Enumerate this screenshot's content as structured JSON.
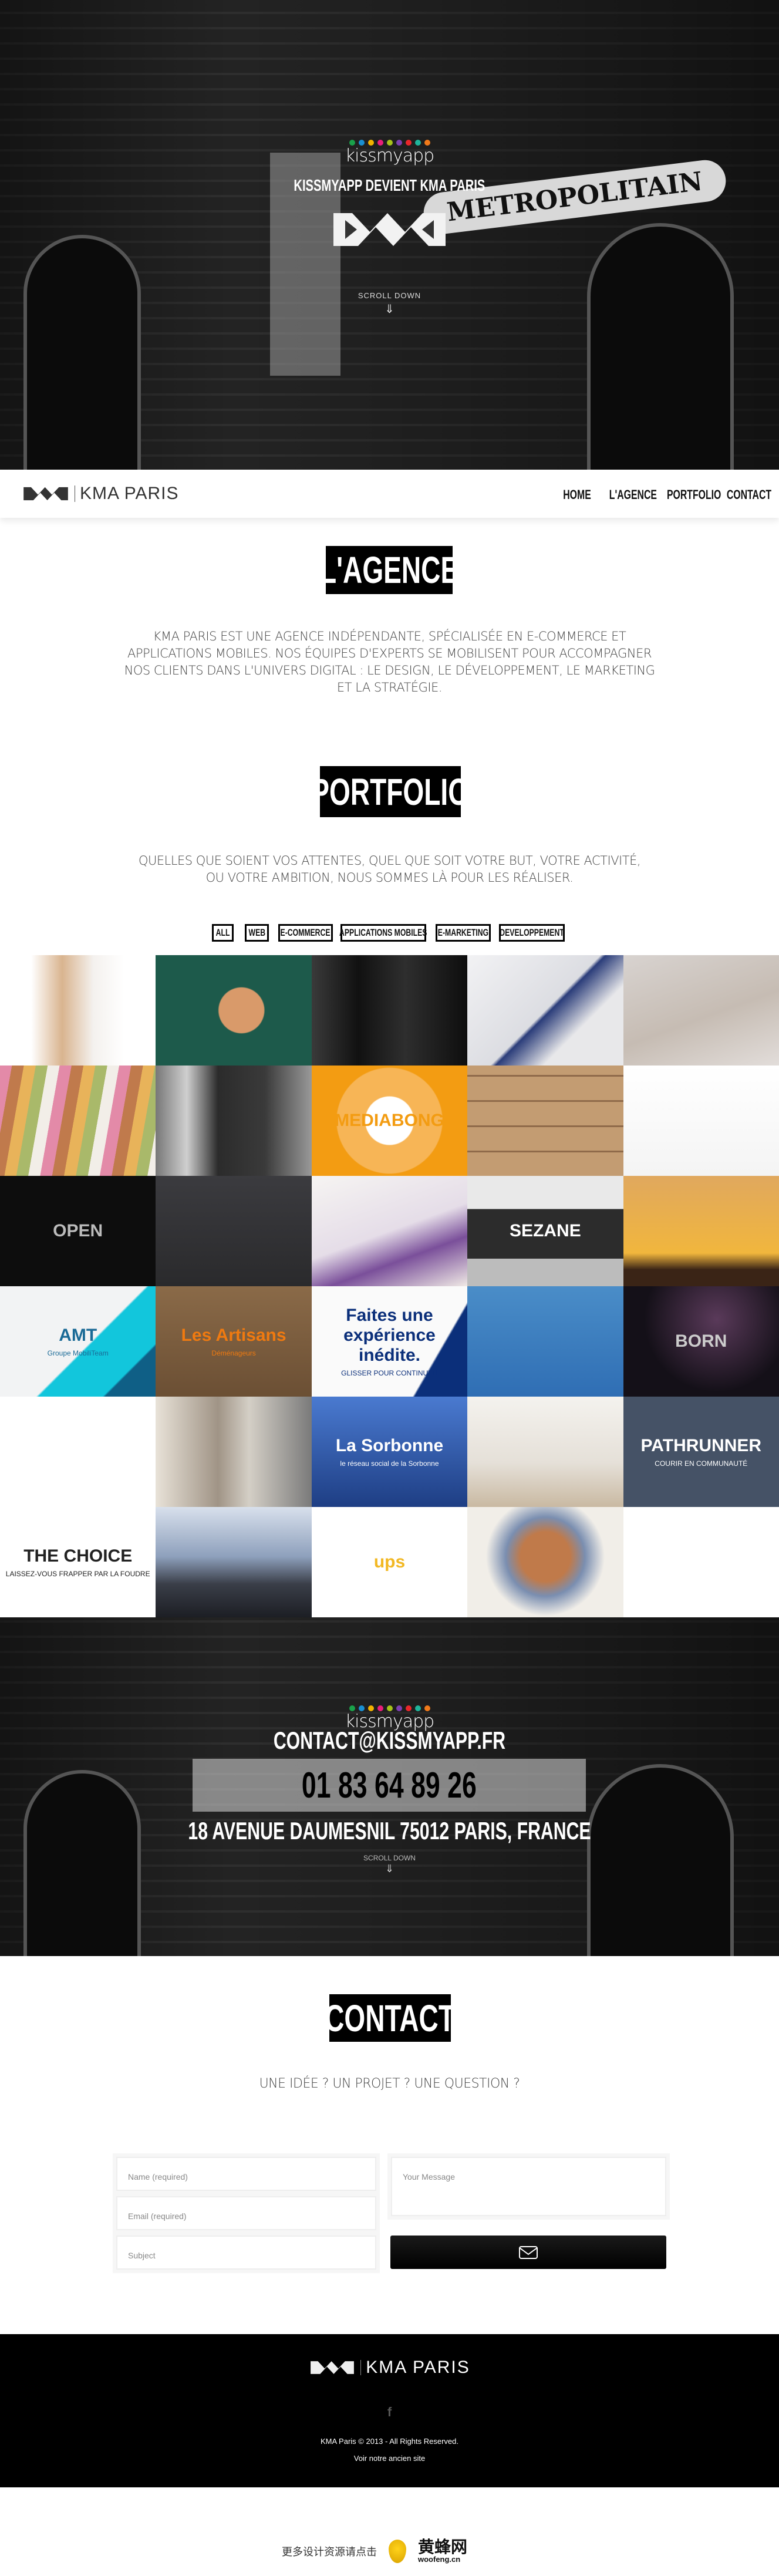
{
  "hero": {
    "brand_dots": [
      "#1aa14a",
      "#1a8fd1",
      "#f2b200",
      "#e91e7a",
      "#a6c21a",
      "#7b3fb0",
      "#e8262a",
      "#1fb39a",
      "#f07a1a"
    ],
    "brand_name": "kissmyapp",
    "title": "KISSMYAPP DEVIENT KMA PARIS",
    "sign_text": "METROPOLITAIN",
    "scroll_label": "SCROLL DOWN"
  },
  "nav": {
    "logo_text": "KMA PARIS",
    "items": [
      {
        "label": "HOME"
      },
      {
        "label": "L'AGENCE"
      },
      {
        "label": "PORTFOLIO"
      },
      {
        "label": "CONTACT"
      }
    ]
  },
  "agence": {
    "heading": "L'AGENCE",
    "text": "KMA PARIS EST UNE AGENCE INDÉPENDANTE, SPÉCIALISÉE EN E-COMMERCE ET APPLICATIONS MOBILES. NOS ÉQUIPES D'EXPERTS SE MOBILISENT POUR ACCOMPAGNER NOS CLIENTS DANS L'UNIVERS DIGITAL : LE DESIGN, LE DÉVELOPPEMENT, LE MARKETING ET LA STRATÉGIE."
  },
  "portfolio": {
    "heading": "PORTFOLIO",
    "text": "QUELLES QUE SOIENT VOS ATTENTES, QUEL QUE SOIT VOTRE BUT, VOTRE ACTIVITÉ, OU VOTRE AMBITION, NOUS SOMMES LÀ POUR LES RÉALISER.",
    "filters": [
      "ALL",
      "WEB",
      "E-COMMERCE",
      "APPLICATIONS MOBILES",
      "E-MARKETING",
      "DEVELOPPEMENT"
    ],
    "tiles": [
      {
        "bg": "linear-gradient(90deg,#fff 20%,#d9b48f 40%,#f4f1ee 60%,#fff 80%)",
        "label": "",
        "color": "#000"
      },
      {
        "bg": "radial-gradient(circle at 55% 50%,#d99a6a 0 22%,#1d5a4b 23%)",
        "label": "",
        "color": "#000"
      },
      {
        "bg": "linear-gradient(90deg,#3a3a3a,#111 30%,#2e2e2e 60%,#0e0e0e)",
        "label": "",
        "color": "#000"
      },
      {
        "bg": "linear-gradient(135deg,#f2f2f4,#dcdde2 50%,#2b3d7a 52%,#e8e8ea 70%)",
        "label": "",
        "color": "#000"
      },
      {
        "bg": "linear-gradient(160deg,#d8d3d0,#c6bcb3 55%,#e2ddda)",
        "label": "",
        "color": "#000"
      },
      {
        "bg": "repeating-linear-gradient(100deg,#e38aa8 0 20px,#c07a4c 20px 40px,#e8b35a 40px 60px,#a9b96a 60px 80px,#f2eee8 80px 100px)",
        "label": "",
        "color": "#000"
      },
      {
        "bg": "linear-gradient(90deg,#777,#cfcfcf 20%,#2b2b2b 40%,#3a3a3a 70%,#999)",
        "label": "",
        "color": "#000"
      },
      {
        "bg": "radial-gradient(circle,#fff 0 25%,#f7b556 26% 55%,#f39c12 56%)",
        "label": "MEDIABONG",
        "color": "#f39c12"
      },
      {
        "bg": "repeating-linear-gradient(0deg,#c39c72 0 40px,#8f6a4a 40px 43px)",
        "label": "",
        "color": "#000"
      },
      {
        "bg": "linear-gradient(#fff,#f4f4f4)",
        "label": "",
        "color": "#000"
      },
      {
        "bg": "#0d0d0d",
        "label": "OPEN",
        "color": "#bbb"
      },
      {
        "bg": "linear-gradient(#3b3b3f,#2a2a2c)",
        "label": "",
        "color": "#000"
      },
      {
        "bg": "linear-gradient(160deg,#f6f4f2,#e5dde8 50%,#7a4f9a 70%,#efe9e5)",
        "label": "",
        "color": "#000"
      },
      {
        "bg": "linear-gradient(#e9e9e9 0 30%,#2c2c2c 30% 75%,#bcbcbc 75%)",
        "label": "SEZANE",
        "color": "#fff"
      },
      {
        "bg": "linear-gradient(#e0a85e,#f1b63d 70%,#3a2416 85%)",
        "label": "",
        "color": "#000"
      },
      {
        "bg": "linear-gradient(135deg,#f2f3f4 55%,#12c6dc 56% 80%,#0f5f86 81%)",
        "label": "AMT",
        "sub": "Groupe MobiliTeam",
        "color": "#1a6a96"
      },
      {
        "bg": "linear-gradient(#8a6a48,#6b4f34)",
        "label": "Les Artisans",
        "sub": "Déménageurs",
        "color": "#f07a10"
      },
      {
        "bg": "linear-gradient(120deg,#fafafa 75%,#0b2f7a 76%)",
        "label": "Faites une expérience inédite.",
        "sub": "GLISSER POUR CONTINUER",
        "color": "#0b2f7a"
      },
      {
        "bg": "linear-gradient(#4a8dc8,#2f6eb4)",
        "label": "",
        "color": "#000"
      },
      {
        "bg": "radial-gradient(circle at 60% 30%,#5a3a5a,#141018 60%)",
        "label": "BORN",
        "color": "#ccc"
      },
      {
        "bg": "#fff",
        "label": "",
        "color": "#e8502a"
      },
      {
        "bg": "linear-gradient(90deg,#e8e2d8,#a09486 40%,#d4cfc6 60%,#7a7a7a)",
        "label": "",
        "color": "#000"
      },
      {
        "bg": "linear-gradient(#4a7ad0,#1e3e84)",
        "label": "La Sorbonne",
        "sub": "le réseau social de la Sorbonne",
        "color": "#fff"
      },
      {
        "bg": "linear-gradient(#f4f2ee,#e5e0d8 60%,#c9b9a2)",
        "label": "",
        "color": "#000"
      },
      {
        "bg": "#455266",
        "label": "PATHRUNNER",
        "sub": "COURIR EN COMMUNAUTÉ",
        "color": "#fff"
      },
      {
        "bg": "#fff",
        "label": "THE CHOICE",
        "sub": "LAISSEZ-VOUS FRAPPER PAR LA FOUDRE",
        "color": "#222"
      },
      {
        "bg": "linear-gradient(#d8e0ec,#8ea0bc 45%,#3a3e48 70%,#1c1e24)",
        "label": "",
        "color": "#000"
      },
      {
        "bg": "#fff",
        "label": "ups",
        "color": "#f2b824"
      },
      {
        "bg": "radial-gradient(circle at 50% 45%,#c07a4a 0 25%,#7a8eb0 40%,#f1eee8 60%)",
        "label": "",
        "color": "#000"
      },
      {
        "bg": "#fff",
        "label": "",
        "color": "#000"
      }
    ]
  },
  "contact_hero": {
    "brand_name": "kissmyapp",
    "email": "CONTACT@KISSMYAPP.FR",
    "phone": "01 83 64 89 26",
    "address": "18 AVENUE DAUMESNIL 75012 PARIS, FRANCE",
    "scroll_label": "SCROLL DOWN"
  },
  "contact": {
    "heading": "CONTACT",
    "text": "UNE IDÉE ? UN PROJET ? UNE QUESTION ?",
    "name_placeholder": "Name (required)",
    "email_placeholder": "Email (required)",
    "subject_placeholder": "Subject",
    "message_placeholder": "Your Message"
  },
  "footer": {
    "logo_text": "KMA PARIS",
    "copyright": "KMA Paris © 2013 - All Rights Reserved.",
    "old_site_link": "Voir notre ancien site"
  },
  "watermark": {
    "text": "更多设计资源请点击",
    "brand": "黄蜂网",
    "domain": "woofeng.cn"
  }
}
